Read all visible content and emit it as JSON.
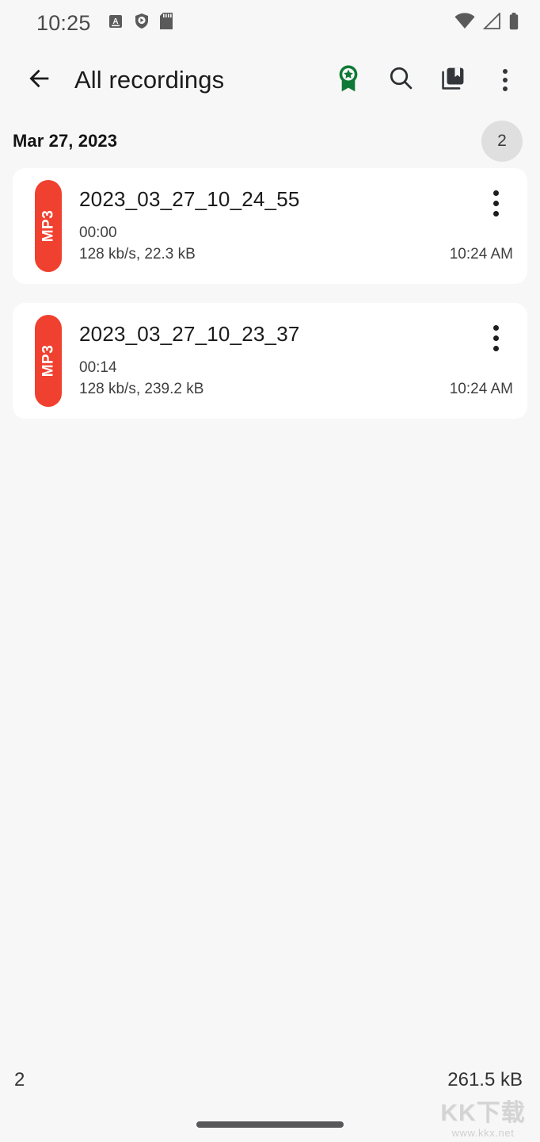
{
  "status_bar": {
    "clock": "10:25",
    "left_icons": [
      "app-notification-icon",
      "play-protect-shield-icon",
      "sd-card-icon"
    ],
    "right_icons": [
      "wifi-icon",
      "cellular-signal-icon",
      "battery-icon"
    ]
  },
  "app_bar": {
    "back_label": "←",
    "title": "All recordings",
    "actions": [
      {
        "name": "award-badge-icon",
        "label": "Premium"
      },
      {
        "name": "search-icon",
        "label": "Search"
      },
      {
        "name": "library-bookmark-icon",
        "label": "Library"
      },
      {
        "name": "overflow-menu-icon",
        "label": "More options"
      }
    ]
  },
  "colors": {
    "page_background": "#f7f7f7",
    "card_background": "#ffffff",
    "format_badge": "#f0402f",
    "accent_green": "#0f7a37",
    "count_chip": "#dfdfdf",
    "primary_text": "#1b1b1b"
  },
  "date_group": {
    "date": "Mar 27, 2023",
    "count": "2"
  },
  "recordings": [
    {
      "format": "MP3",
      "title": "2023_03_27_10_24_55",
      "duration": "00:00",
      "meta": "128 kb/s, 22.3 kB",
      "time": "10:24 AM"
    },
    {
      "format": "MP3",
      "title": "2023_03_27_10_23_37",
      "duration": "00:14",
      "meta": "128 kb/s, 239.2 kB",
      "time": "10:24 AM"
    }
  ],
  "summary": {
    "count": "2",
    "total_size": "261.5 kB"
  },
  "watermark": {
    "logo": "KK下载",
    "url": "www.kkx.net"
  }
}
